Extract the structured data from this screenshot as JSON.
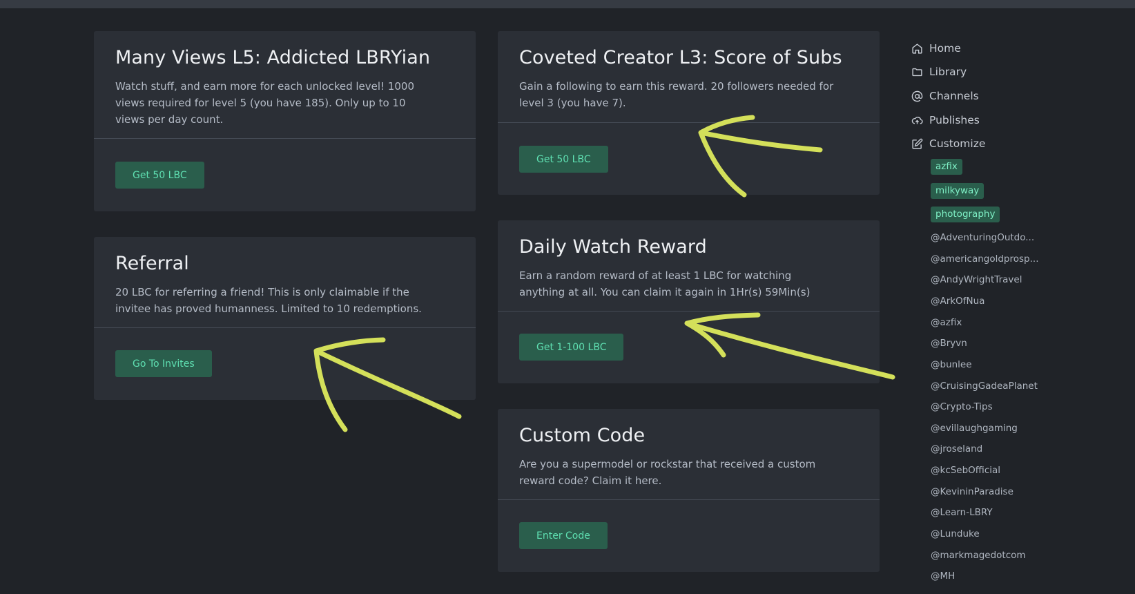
{
  "cards": [
    {
      "title": "Many Views L5: Addicted LBRYian",
      "desc": "Watch stuff, and earn more for each unlocked level! 1000 views required for level 5 (you have 185). Only up to 10 views per day count.",
      "button": "Get 50 LBC"
    },
    {
      "title": "Referral",
      "desc": "20 LBC for referring a friend! This is only claimable if the invitee has proved humanness. Limited to 10 redemptions.",
      "button": "Go To Invites"
    },
    {
      "title": "Coveted Creator L3: Score of Subs",
      "desc": "Gain a following to earn this reward. 20 followers needed for level 3 (you have 7).",
      "button": "Get 50 LBC"
    },
    {
      "title": "Daily Watch Reward",
      "desc": "Earn a random reward of at least 1 LBC for watching anything at all. You can claim it again in 1Hr(s) 59Min(s)",
      "button": "Get 1-100 LBC"
    },
    {
      "title": "Custom Code",
      "desc": "Are you a supermodel or rockstar that received a custom reward code? Claim it here.",
      "button": "Enter Code"
    }
  ],
  "sidebar": {
    "nav": [
      {
        "label": "Home",
        "icon": "home-icon"
      },
      {
        "label": "Library",
        "icon": "folder-icon"
      },
      {
        "label": "Channels",
        "icon": "at-icon"
      },
      {
        "label": "Publishes",
        "icon": "cloud-upload-icon"
      },
      {
        "label": "Customize",
        "icon": "edit-icon"
      }
    ],
    "tags": [
      "azfix",
      "milkyway",
      "photography"
    ],
    "channels": [
      "@AdventuringOutdo...",
      "@americangoldprosp...",
      "@AndyWrightTravel",
      "@ArkOfNua",
      "@azfix",
      "@Bryvn",
      "@bunlee",
      "@CruisingGadeaPlanet",
      "@Crypto-Tips",
      "@evillaughgaming",
      "@jroseland",
      "@kcSebOfficial",
      "@KevininParadise",
      "@Learn-LBRY",
      "@Lunduke",
      "@markmagedotcom",
      "@MH"
    ]
  },
  "colors": {
    "background": "#202328",
    "card": "#2b2f36",
    "button_bg": "#2a5e4c",
    "button_text": "#5fe0b2",
    "annotation": "#d4e05a"
  }
}
